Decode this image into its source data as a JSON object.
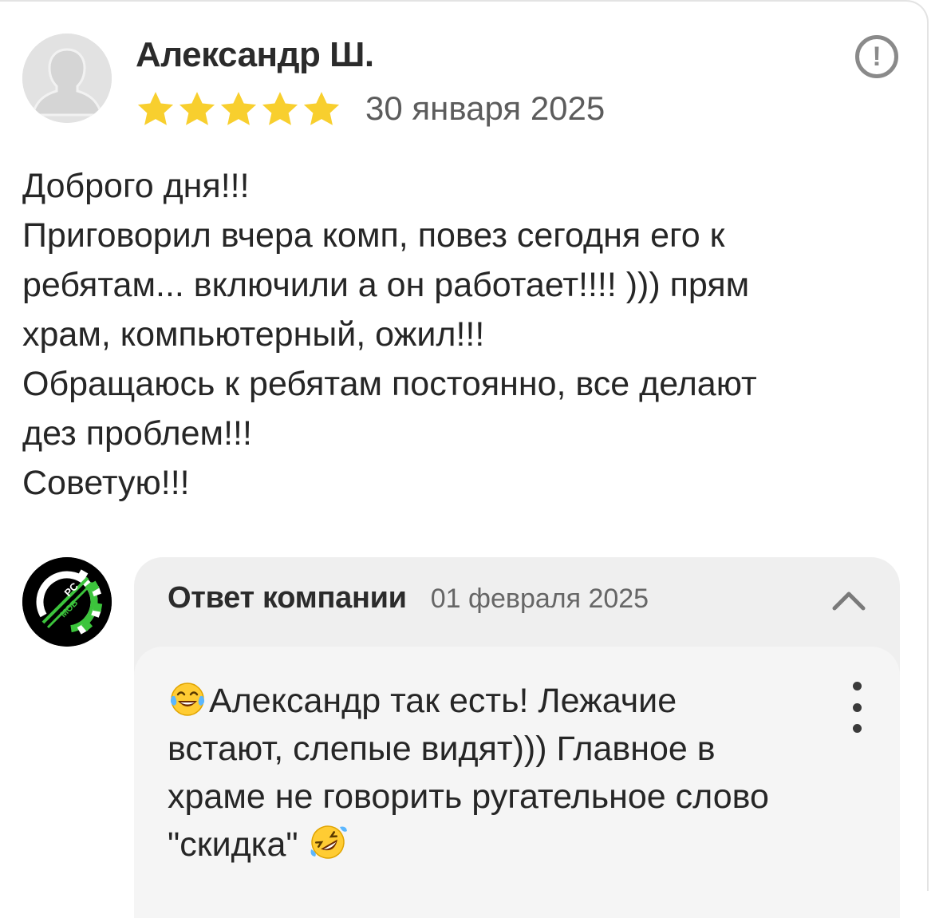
{
  "review": {
    "author": "Александр Ш.",
    "rating": 5,
    "rating_max": 5,
    "date": "30 января 2025",
    "report_icon": "!",
    "text_lines": [
      "Доброго дня!!!",
      "Приговорил вчера комп, повез сегодня его к",
      "ребятам... включили а он работает!!!! ))) прям",
      "храм, компьютерный, ожил!!!",
      "Обращаюсь к ребятам постоянно, все делают",
      "дез проблем!!!",
      "Советую!!!"
    ]
  },
  "reply": {
    "title": "Ответ компании",
    "date": "01 февраля 2025",
    "logo_text": "PC MOB",
    "text_lines": [
      "Александр так есть! Лежачие",
      "встают, слепые видят))) Главное в",
      "храме не говорить ругательное слово",
      "\"скидка\""
    ],
    "leading_emoji": "face-with-tears-of-joy",
    "trailing_emoji": "rolling-on-the-floor-laughing"
  },
  "colors": {
    "star": "#f8cf2e",
    "logo_green": "#3cc43c",
    "reply_bg": "#efefef"
  }
}
